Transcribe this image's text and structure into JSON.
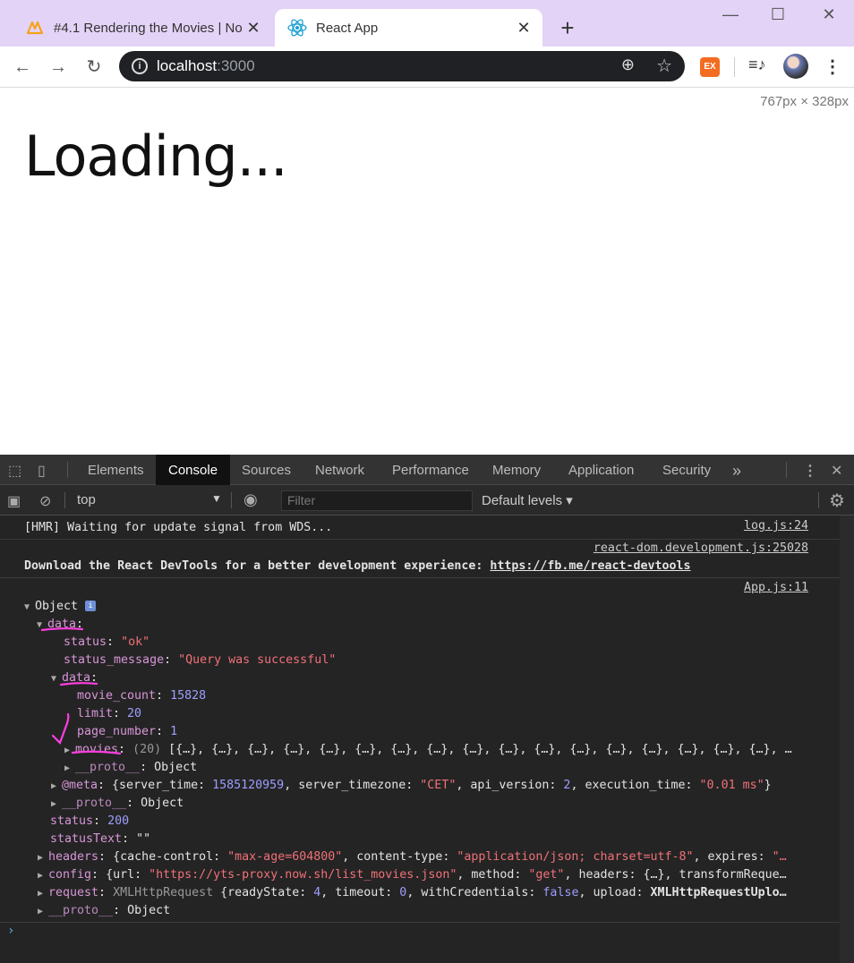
{
  "browser": {
    "tabs": [
      {
        "title": "#4.1 Rendering the Movies | No",
        "close": "✕",
        "active": false
      },
      {
        "title": "React App",
        "close": "✕",
        "active": true
      }
    ],
    "new_tab": "+",
    "url_host": "localhost",
    "url_port": ":3000",
    "extension_label": "EX"
  },
  "viewport": {
    "dimensions": "767px × 328px",
    "text": "Loading..."
  },
  "devtools": {
    "tabs": [
      "Elements",
      "Console",
      "Sources",
      "Network",
      "Performance",
      "Memory",
      "Application",
      "Security",
      "»"
    ],
    "active_tab": "Console",
    "context": "top",
    "filter_placeholder": "Filter",
    "levels": "Default levels",
    "messages": {
      "hmr": {
        "text": "[HMR] Waiting for update signal from WDS...",
        "source": "log.js:24"
      },
      "devtools": {
        "text": "Download the React DevTools for a better development experience: ",
        "link": "https://fb.me/react-devtools",
        "source": "react-dom.development.js:25028"
      },
      "object_source": "App.js:11"
    },
    "object": {
      "root": "Object",
      "data_key": "data",
      "status_key": "status",
      "status_val": "\"ok\"",
      "status_message_key": "status_message",
      "status_message_val": "\"Query was successful\"",
      "inner_data_key": "data",
      "movie_count_key": "movie_count",
      "movie_count_val": "15828",
      "limit_key": "limit",
      "limit_val": "20",
      "page_number_key": "page_number",
      "page_number_val": "1",
      "movies_key": "movies",
      "movies_count": "(20)",
      "movies_val": "[{…}, {…}, {…}, {…}, {…}, {…}, {…}, {…}, {…}, {…}, {…}, {…}, {…}, {…}, {…}, {…}, {…}, …",
      "proto_key": "__proto__",
      "proto_val": "Object",
      "meta_key": "@meta",
      "meta_prefix": "{server_time: ",
      "meta_server_time": "1585120959",
      "meta_tz_key": ", server_timezone: ",
      "meta_tz_val": "\"CET\"",
      "meta_api_key": ", api_version: ",
      "meta_api_val": "2",
      "meta_exec_key": ", execution_time: ",
      "meta_exec_val": "\"0.01 ms\"",
      "meta_suffix": "}",
      "status2_key": "status",
      "status2_val": "200",
      "statusText_key": "statusText",
      "statusText_val": "\"\"",
      "headers_key": "headers",
      "headers_p1": "{cache-control: ",
      "headers_v1": "\"max-age=604800\"",
      "headers_p2": ", content-type: ",
      "headers_v2": "\"application/json; charset=utf-8\"",
      "headers_p3": ", expires: ",
      "headers_v3": "\"…",
      "config_key": "config",
      "config_p1": "{url: ",
      "config_v1": "\"https://yts-proxy.now.sh/list_movies.json\"",
      "config_p2": ", method: ",
      "config_v2": "\"get\"",
      "config_p3": ", headers: {…}, transformReque…",
      "request_key": "request",
      "request_type": "XMLHttpRequest",
      "request_p1": " {readyState: ",
      "request_v1": "4",
      "request_p2": ", timeout: ",
      "request_v2": "0",
      "request_p3": ", withCredentials: ",
      "request_v3": "false",
      "request_p4": ", upload: ",
      "request_v4": "XMLHttpRequestUplo…",
      "proto2_key": "__proto__",
      "proto2_val": "Object"
    },
    "prompt": "›"
  },
  "colors": {
    "tabstrip": "#e3d3f6",
    "devtools_bg": "#242424",
    "annotation": "#ff3ee0"
  }
}
